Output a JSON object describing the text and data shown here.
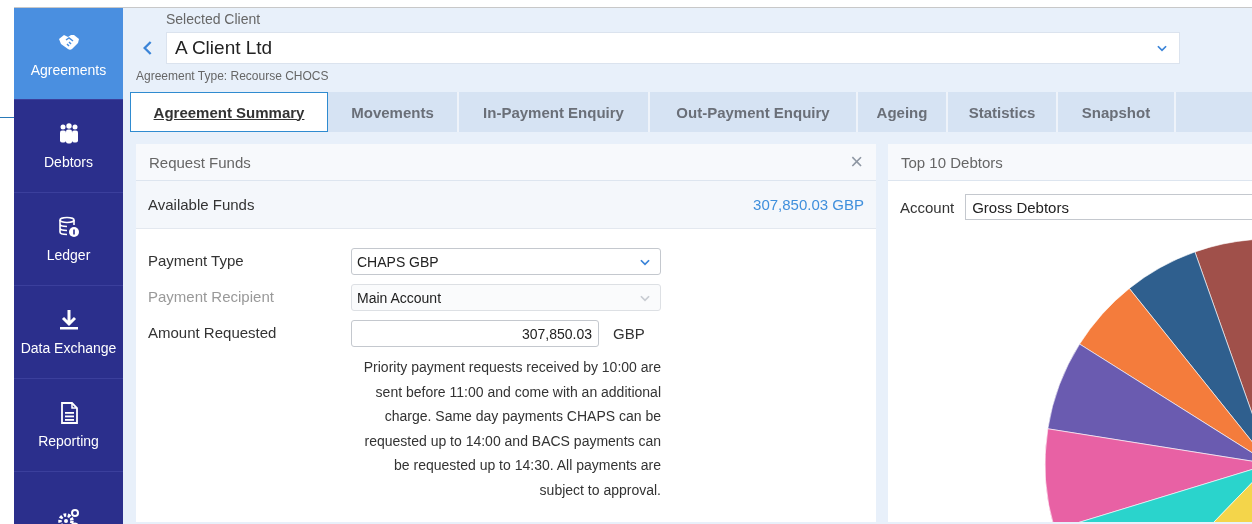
{
  "sidebar": {
    "items": [
      {
        "label": "Agreements",
        "selected": true
      },
      {
        "label": "Debtors",
        "selected": false
      },
      {
        "label": "Ledger",
        "selected": false
      },
      {
        "label": "Data Exchange",
        "selected": false
      },
      {
        "label": "Reporting",
        "selected": false
      },
      {
        "selected": false
      }
    ]
  },
  "client": {
    "label": "Selected Client",
    "value": "A Client Ltd",
    "agreement_type": "Agreement Type: Recourse CHOCS"
  },
  "tabs": [
    {
      "label": "Agreement Summary",
      "selected": true
    },
    {
      "label": "Movements",
      "selected": false
    },
    {
      "label": "In-Payment Enquiry",
      "selected": false
    },
    {
      "label": "Out-Payment Enquiry",
      "selected": false
    },
    {
      "label": "Ageing",
      "selected": false
    },
    {
      "label": "Statistics",
      "selected": false
    },
    {
      "label": "Snapshot",
      "selected": false
    }
  ],
  "request_funds": {
    "title": "Request Funds",
    "close": "×",
    "available_label": "Available Funds",
    "available_value": "307,850.03 GBP",
    "fields": [
      {
        "kind": "select",
        "label": "Payment Type",
        "value": "CHAPS GBP",
        "disabled": false
      },
      {
        "kind": "select",
        "label": "Payment Recipient",
        "value": "Main Account",
        "disabled": true
      },
      {
        "kind": "amount",
        "label": "Amount Requested",
        "value": "307,850.03",
        "unit": "GBP",
        "disabled": false
      }
    ],
    "note": "Priority payment requests received by 10:00 are sent before 11:00 and come with an additional charge. Same day payments CHAPS can be requested up to 14:00 and BACS payments can be requested up to 14:30. All payments are subject to approval."
  },
  "top_debtors": {
    "title": "Top 10 Debtors",
    "account_label": "Account",
    "account_value": "Gross Debtors"
  }
}
